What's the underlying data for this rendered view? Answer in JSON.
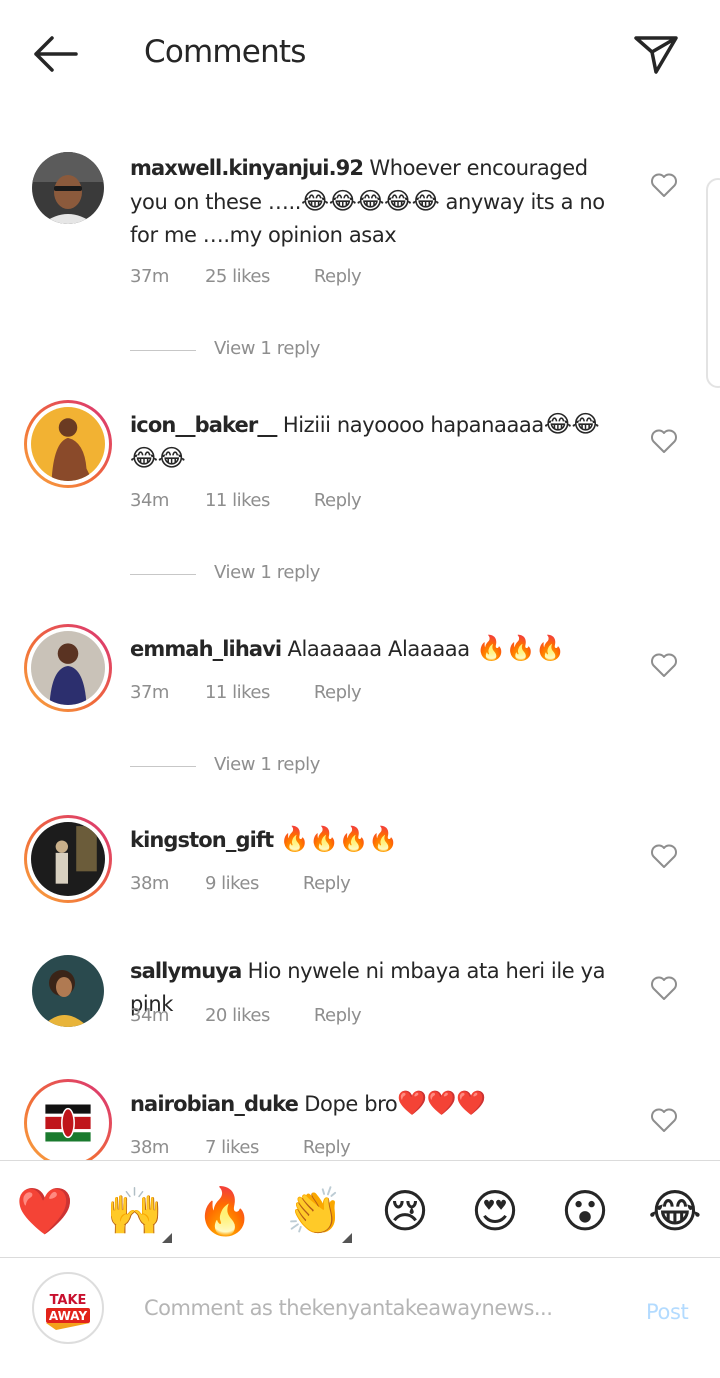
{
  "header": {
    "title": "Comments"
  },
  "comments": [
    {
      "user": "maxwell.kinyanjui.92",
      "text": "Whoever encouraged you on these …..",
      "emojis": "😂😂😂😂😂",
      "text_after": " anyway its a no for me ….my opinion asax",
      "time": "37m",
      "likes": "25 likes",
      "reply": "Reply",
      "view_reply": "View 1 reply"
    },
    {
      "user": "icon__baker__",
      "text": "Hiziii nayoooo hapanaaaa",
      "emojis": "😂😂😂😂",
      "time": "34m",
      "likes": "11 likes",
      "reply": "Reply",
      "view_reply": "View 1 reply"
    },
    {
      "user": "emmah_lihavi",
      "text": "Alaaaaaa Alaaaaa ",
      "emojis": "🔥🔥🔥",
      "time": "37m",
      "likes": "11 likes",
      "reply": "Reply",
      "view_reply": "View 1 reply"
    },
    {
      "user": "kingston_gift",
      "text": "",
      "emojis": "🔥🔥🔥🔥",
      "time": "38m",
      "likes": "9 likes",
      "reply": "Reply"
    },
    {
      "user": "sallymuya",
      "text": "Hio nywele ni mbaya ata heri ile ya pink",
      "time": "34m",
      "likes": "20 likes",
      "reply": "Reply"
    },
    {
      "user": "nairobian_duke",
      "text": "Dope bro",
      "emojis": "❤️❤️❤️",
      "time": "38m",
      "likes": "7 likes",
      "reply": "Reply"
    }
  ],
  "emoji_bar": [
    "❤️",
    "🙌",
    "🔥",
    "👏",
    "😢",
    "😍",
    "😮",
    "😂"
  ],
  "composer": {
    "placeholder": "Comment as thekenyantakeawaynews...",
    "post_label": "Post",
    "avatar_text_top": "TAKE",
    "avatar_text_bottom": "AWAY"
  },
  "colors": {
    "accent_disabled": "#b3dbff",
    "story_ring_start": "#f9a93f",
    "story_ring_end": "#d8307a",
    "secondary_text": "#8e8e8e"
  }
}
